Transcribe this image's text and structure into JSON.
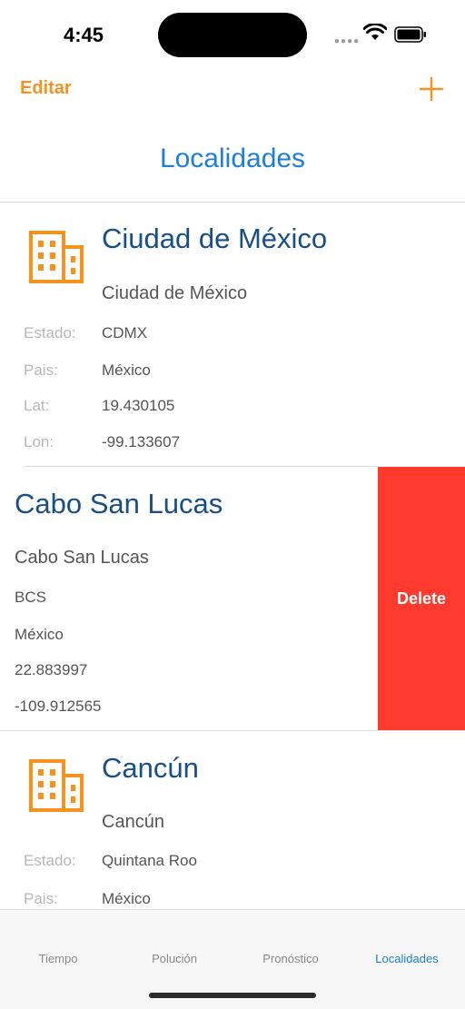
{
  "status_bar": {
    "time": "4:45"
  },
  "nav": {
    "edit_label": "Editar",
    "title": "Localidades"
  },
  "labels": {
    "state": "Estado:",
    "country": "Pais:",
    "lat": "Lat:",
    "lon": "Lon:"
  },
  "locations": [
    {
      "title": "Ciudad de México",
      "subtitle": "Ciudad de México",
      "state": "CDMX",
      "country": "México",
      "lat": "19.430105",
      "lon": "-99.133607"
    },
    {
      "title": "Cabo San Lucas",
      "subtitle": "Cabo San Lucas",
      "state": "BCS",
      "country": "México",
      "lat": "22.883997",
      "lon": "-109.912565"
    },
    {
      "title": "Cancún",
      "subtitle": "Cancún",
      "state": "Quintana Roo",
      "country": "México"
    }
  ],
  "swipe_action": {
    "label": "Delete",
    "color": "#ff3b30"
  },
  "tabs": [
    {
      "label": "Tiempo"
    },
    {
      "label": "Polución"
    },
    {
      "label": "Pronóstico"
    },
    {
      "label": "Localidades",
      "active": true
    }
  ],
  "colors": {
    "accent_orange": "#f6921e",
    "accent_blue": "#1d7fdc",
    "title_blue": "#174f86"
  }
}
